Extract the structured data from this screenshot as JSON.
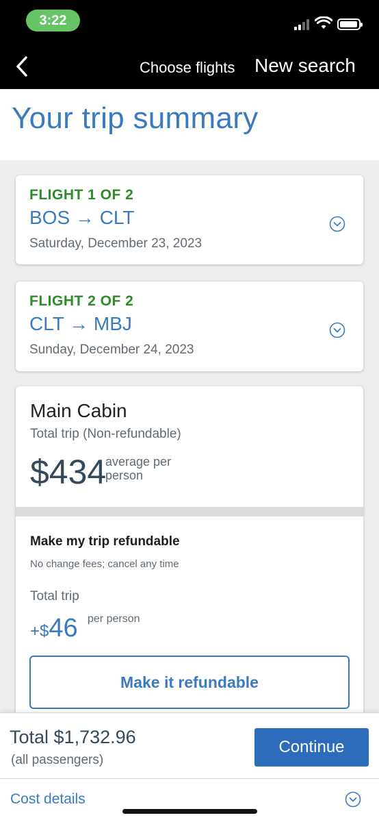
{
  "status_bar": {
    "time": "3:22"
  },
  "header": {
    "choose_flights": "Choose flights",
    "new_search": "New search"
  },
  "title": "Your trip summary",
  "flights": [
    {
      "heading": "FLIGHT 1 OF 2",
      "route": "BOS → CLT",
      "date": "Saturday, December 23, 2023"
    },
    {
      "heading": "FLIGHT 2 OF 2",
      "route": "CLT → MBJ",
      "date": "Sunday, December 24, 2023"
    }
  ],
  "cabin": {
    "name": "Main Cabin",
    "subtitle": "Total trip (Non-refundable)",
    "price": "$434",
    "price_note": "average per person"
  },
  "refund": {
    "title": "Make my trip refundable",
    "subtitle": "No change fees; cancel any time",
    "total_label": "Total trip",
    "price_prefix": "+$",
    "price": "46",
    "price_note": "per person",
    "button": "Make it refundable"
  },
  "footer": {
    "total": "Total $1,732.96",
    "total_sub": "(all passengers)",
    "continue": "Continue",
    "cost_details": "Cost details"
  },
  "colors": {
    "brand_blue": "#3a7bbf",
    "button_blue": "#2c6cba",
    "flight_green": "#2e8b2a",
    "time_pill_green": "#65c466"
  }
}
